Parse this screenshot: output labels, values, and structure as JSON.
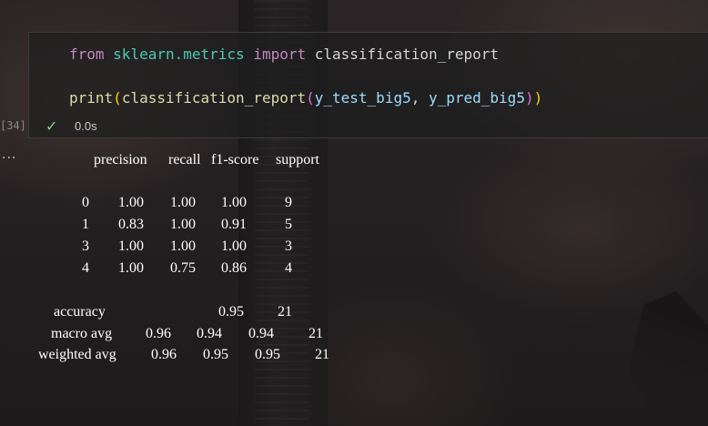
{
  "cell": {
    "execution_count": "[34]",
    "code": {
      "line1": {
        "from": "from",
        "module": "sklearn.metrics",
        "import": "import",
        "name": "classification_report"
      },
      "line2": {
        "func_outer": "print",
        "paren_open_1": "(",
        "func_inner": "classification_report",
        "paren_open_2": "(",
        "arg1": "y_test_big5",
        "comma": ", ",
        "arg2": "y_pred_big5",
        "paren_close_2": ")",
        "paren_close_1": ")"
      }
    },
    "status": {
      "icon": "check-icon",
      "elapsed": "0.0s"
    }
  },
  "output": {
    "ellipsis": "···",
    "headers": [
      "precision",
      "recall",
      "f1-score",
      "support"
    ],
    "rows": [
      {
        "label": "0",
        "precision": "1.00",
        "recall": "1.00",
        "f1": "1.00",
        "support": "9"
      },
      {
        "label": "1",
        "precision": "0.83",
        "recall": "1.00",
        "f1": "0.91",
        "support": "5"
      },
      {
        "label": "3",
        "precision": "1.00",
        "recall": "1.00",
        "f1": "1.00",
        "support": "3"
      },
      {
        "label": "4",
        "precision": "1.00",
        "recall": "0.75",
        "f1": "0.86",
        "support": "4"
      }
    ],
    "accuracy": {
      "label": "accuracy",
      "f1": "0.95",
      "support": "21"
    },
    "macro_avg": {
      "label": "macro avg",
      "precision": "0.96",
      "recall": "0.94",
      "f1": "0.94",
      "support": "21"
    },
    "weighted_avg": {
      "label": "weighted avg",
      "precision": "0.96",
      "recall": "0.95",
      "f1": "0.95",
      "support": "21"
    }
  },
  "colors": {
    "keyword": "#c586c0",
    "module": "#4ec9b0",
    "function": "#dcdcaa",
    "variable": "#9cdcfe",
    "success": "#89d185"
  }
}
